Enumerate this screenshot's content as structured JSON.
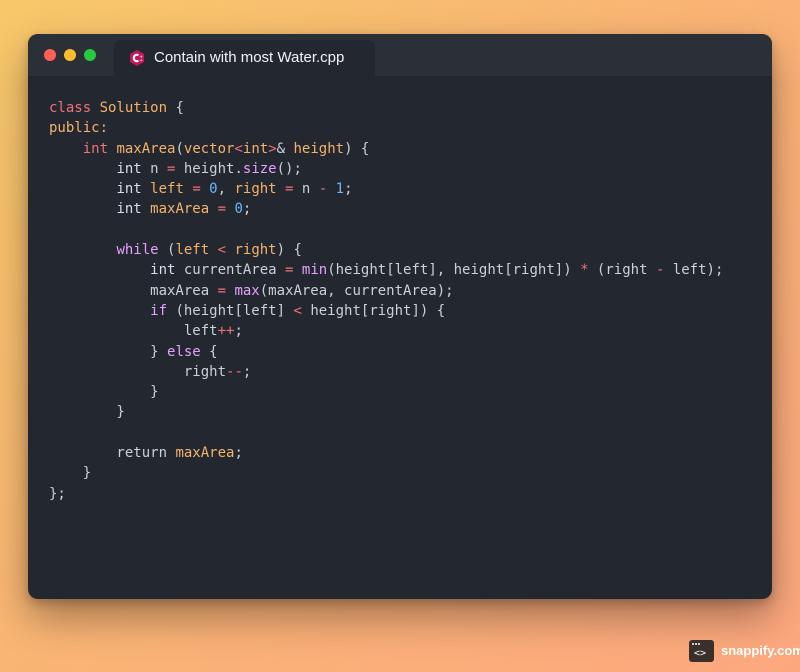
{
  "window": {
    "tab_title": "Contain with most Water.cpp",
    "icon": "cpp-file-icon"
  },
  "colors": {
    "close": "#ff5f57",
    "minimize": "#febc2e",
    "maximize": "#28c840",
    "editor_bg": "#23272f"
  },
  "code_lines": [
    [
      [
        "kw",
        "class "
      ],
      [
        "name",
        "Solution"
      ],
      [
        "plain",
        " {"
      ]
    ],
    [
      [
        "name",
        "public:"
      ]
    ],
    [
      [
        "plain",
        "    "
      ],
      [
        "kw",
        "int "
      ],
      [
        "name",
        "maxArea"
      ],
      [
        "plain",
        "("
      ],
      [
        "name",
        "vector"
      ],
      [
        "op",
        "<"
      ],
      [
        "name",
        "int"
      ],
      [
        "op",
        ">"
      ],
      [
        "plain",
        "& "
      ],
      [
        "name",
        "height"
      ],
      [
        "plain",
        ") {"
      ]
    ],
    [
      [
        "plain",
        "        "
      ],
      [
        "type",
        "int "
      ],
      [
        "var",
        "n "
      ],
      [
        "op",
        "= "
      ],
      [
        "plain",
        "height."
      ],
      [
        "fn",
        "size"
      ],
      [
        "plain",
        "();"
      ]
    ],
    [
      [
        "plain",
        "        "
      ],
      [
        "type",
        "int "
      ],
      [
        "name",
        "left "
      ],
      [
        "op",
        "= "
      ],
      [
        "num",
        "0"
      ],
      [
        "plain",
        ", "
      ],
      [
        "name",
        "right "
      ],
      [
        "op",
        "= "
      ],
      [
        "plain",
        "n "
      ],
      [
        "op",
        "- "
      ],
      [
        "num",
        "1"
      ],
      [
        "plain",
        ";"
      ]
    ],
    [
      [
        "plain",
        "        "
      ],
      [
        "type",
        "int "
      ],
      [
        "name",
        "maxArea "
      ],
      [
        "op",
        "= "
      ],
      [
        "num",
        "0"
      ],
      [
        "plain",
        ";"
      ]
    ],
    [
      [
        "plain",
        ""
      ]
    ],
    [
      [
        "plain",
        "        "
      ],
      [
        "fn",
        "while "
      ],
      [
        "plain",
        "("
      ],
      [
        "name",
        "left "
      ],
      [
        "op",
        "< "
      ],
      [
        "name",
        "right"
      ],
      [
        "plain",
        ") {"
      ]
    ],
    [
      [
        "plain",
        "            "
      ],
      [
        "type",
        "int "
      ],
      [
        "var",
        "currentArea "
      ],
      [
        "op",
        "= "
      ],
      [
        "fn",
        "min"
      ],
      [
        "plain",
        "(height[left], height[right]) "
      ],
      [
        "op",
        "* "
      ],
      [
        "plain",
        "(right "
      ],
      [
        "op",
        "- "
      ],
      [
        "plain",
        "left);"
      ]
    ],
    [
      [
        "plain",
        "            maxArea "
      ],
      [
        "op",
        "= "
      ],
      [
        "fn",
        "max"
      ],
      [
        "plain",
        "(maxArea, currentArea);"
      ]
    ],
    [
      [
        "plain",
        "            "
      ],
      [
        "fn",
        "if "
      ],
      [
        "plain",
        "(height[left] "
      ],
      [
        "op",
        "< "
      ],
      [
        "plain",
        "height[right]) {"
      ]
    ],
    [
      [
        "plain",
        "                left"
      ],
      [
        "op",
        "++"
      ],
      [
        "plain",
        ";"
      ]
    ],
    [
      [
        "plain",
        "            } "
      ],
      [
        "fn",
        "else "
      ],
      [
        "plain",
        "{"
      ]
    ],
    [
      [
        "plain",
        "                right"
      ],
      [
        "op",
        "--"
      ],
      [
        "plain",
        ";"
      ]
    ],
    [
      [
        "plain",
        "            }"
      ]
    ],
    [
      [
        "plain",
        "        }"
      ]
    ],
    [
      [
        "plain",
        ""
      ]
    ],
    [
      [
        "plain",
        "        return "
      ],
      [
        "name",
        "maxArea"
      ],
      [
        "plain",
        ";"
      ]
    ],
    [
      [
        "plain",
        "    }"
      ]
    ],
    [
      [
        "plain",
        "};"
      ]
    ]
  ],
  "brand": {
    "text": "snappify.com",
    "icon": "snappify-logo-icon"
  }
}
